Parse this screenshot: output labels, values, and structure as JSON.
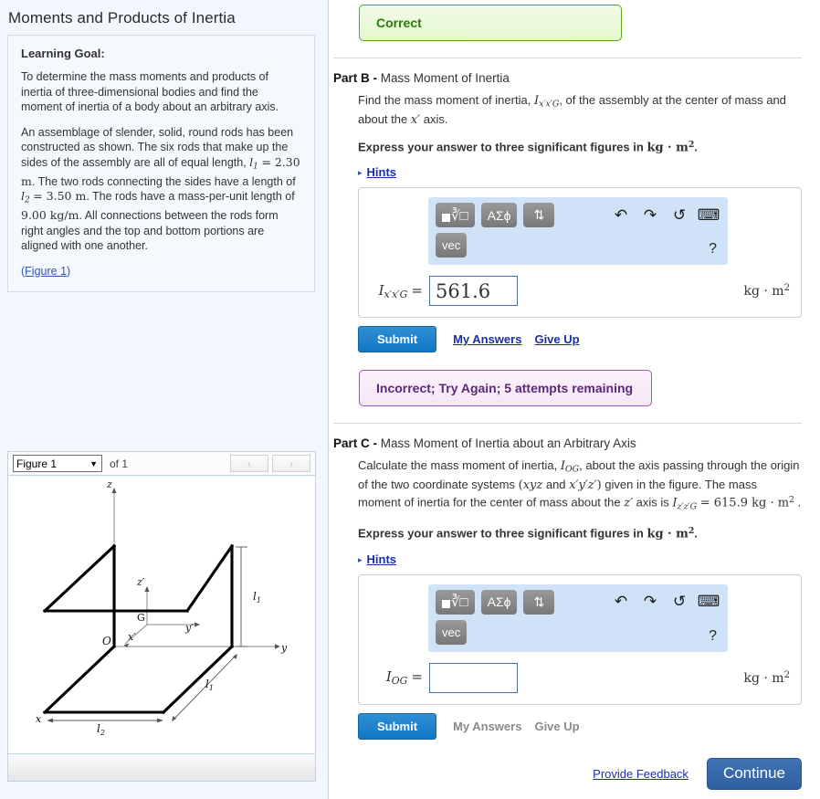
{
  "left": {
    "page_title": "Moments and Products of Inertia",
    "goal": {
      "heading": "Learning Goal:",
      "paragraph1": "To determine the mass moments and products of inertia of three-dimensional bodies and find the moment of inertia of a body about an arbitrary axis.",
      "paragraph2_a": "An assemblage of slender, solid, round rods has been constructed as shown. The six rods that make up the sides of the assembly are all of equal length,",
      "l1_eq": "l",
      "l1_sub": "1",
      "l1_val": "= 2.30 m",
      "paragraph2_b": ". The two rods connecting the sides have a length of",
      "l2_eq": "l",
      "l2_sub": "2",
      "l2_val": "= 3.50 m",
      "paragraph2_c": ". The rods have a mass-per-unit length of",
      "mu_val": "9.00 kg/m",
      "paragraph2_d": ". All connections between the rods form right angles and the top and bottom portions are aligned with one another.",
      "figure_link": "Figure 1",
      "figure_link_open": "(",
      "figure_link_close": ")"
    },
    "figure_panel": {
      "selected_figure": "Figure 1",
      "of_label": "of 1",
      "prev_label": "‹",
      "next_label": "›",
      "caret": "▼",
      "diagram_labels": {
        "z": "z",
        "y": "y",
        "x": "x",
        "z_prime": "z′",
        "y_prime": "y′",
        "x_prime": "x′",
        "origin": "O",
        "center_of_mass": "G",
        "l1_right": "l",
        "l1_right_sub": "1",
        "l1_front": "l",
        "l1_front_sub": "1",
        "l2_bottom": "l",
        "l2_bottom_sub": "2"
      }
    }
  },
  "right": {
    "feedback_correct": "Correct",
    "feedback_incorrect": "Incorrect; Try Again; 5 attempts remaining",
    "part_b": {
      "label": "Part B -",
      "title": "Mass Moment of Inertia",
      "prompt_1": "Find the mass moment of inertia,",
      "symbol_I": "I",
      "symbol_sub": "x′x′G",
      "prompt_2": ", of the assembly at the center of mass and about the",
      "axis_symbol": "x′",
      "prompt_3": "axis.",
      "instruction_pre": "Express your answer to three significant figures in",
      "instruction_unit": "kg · m",
      "instruction_exp": "2",
      "instruction_post": ".",
      "hints_label": "Hints",
      "hints_triangle": "▸",
      "answer_label_I": "I",
      "answer_label_sub": "x′x′G",
      "answer_label_eq": "=",
      "answer_value": "561.6",
      "answer_unit": "kg · m",
      "answer_unit_exp": "2",
      "submit_label": "Submit",
      "my_answers_label": "My Answers",
      "give_up_label": "Give Up"
    },
    "part_c": {
      "label": "Part C -",
      "title": "Mass Moment of Inertia about an Arbitrary Axis",
      "prompt_1": "Calculate the mass moment of inertia,",
      "symbol_I": "I",
      "symbol_sub": "OG",
      "prompt_2": ", about the axis passing through the origin of the two coordinate systems",
      "coord_1": "xyz",
      "coord_and": "and",
      "coord_2": "x′y′z′",
      "prompt_3": "given in the figure. The mass moment of inertia for the center of mass about the",
      "axis_symbol": "z′",
      "prompt_4": "axis is",
      "given_I": "I",
      "given_sub": "z′z′G",
      "given_value": "= 615.9 kg · m",
      "given_exp": "2",
      "instruction_pre": "Express your answer to three significant figures in",
      "instruction_unit": "kg · m",
      "instruction_exp": "2",
      "instruction_post": ".",
      "hints_label": "Hints",
      "hints_triangle": "▸",
      "answer_label_I": "I",
      "answer_label_sub": "OG",
      "answer_label_eq": "=",
      "answer_value": "",
      "answer_unit": "kg · m",
      "answer_unit_exp": "2",
      "submit_label": "Submit",
      "my_answers_label": "My Answers",
      "give_up_label": "Give Up"
    },
    "math_toolbar": {
      "root_label": "√",
      "greek_label": "ΑΣϕ",
      "updown_label": "⇅",
      "vec_label": "vec",
      "undo_label": "↶",
      "redo_label": "↷",
      "reset_label": "↺",
      "keyboard_label": "⌨",
      "help_label": "?"
    },
    "provide_feedback": "Provide Feedback",
    "continue_label": "Continue"
  },
  "colors": {
    "accent_blue": "#1277c2",
    "continue_blue": "#2f5f9e",
    "correct_green": "#2b7a0b",
    "incorrect_purple": "#5b2a77",
    "toolbar_blue": "#cfe2f7",
    "link_blue": "#1a2ea8"
  }
}
